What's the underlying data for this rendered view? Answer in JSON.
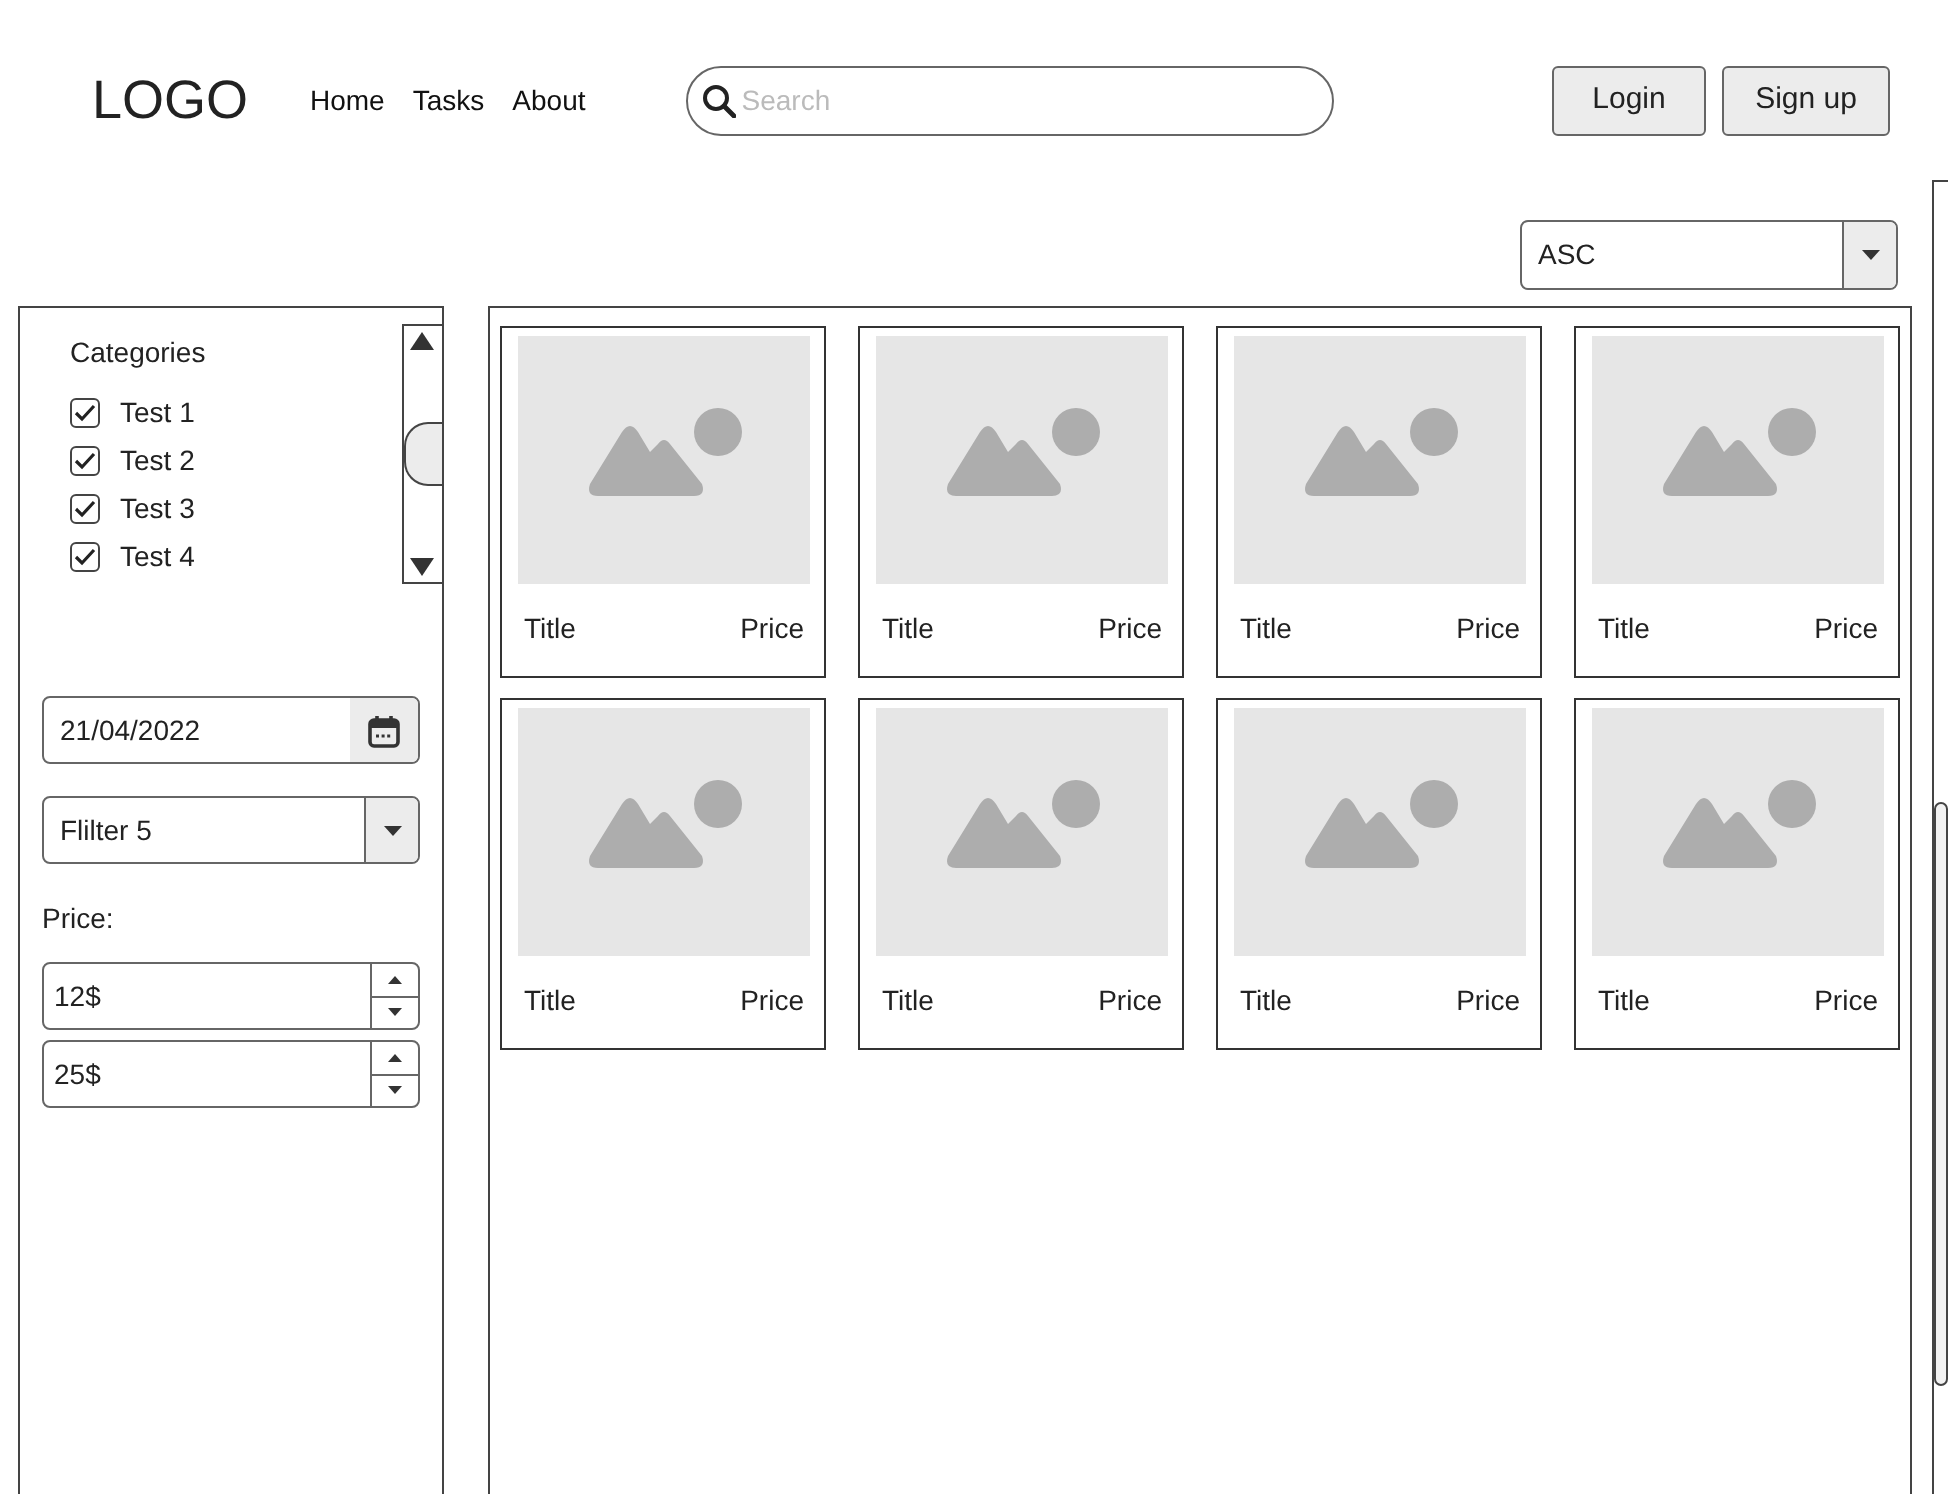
{
  "logo": "LOGO",
  "nav": [
    {
      "label": "Home"
    },
    {
      "label": "Tasks"
    },
    {
      "label": "About"
    }
  ],
  "search": {
    "placeholder": "Search"
  },
  "buttons": [
    "Login",
    "Sign up"
  ],
  "sort": {
    "value": "ASC"
  },
  "sidebar": {
    "categories_title": "Categories",
    "categories": [
      {
        "label": "Test 1",
        "checked": true
      },
      {
        "label": "Test 2",
        "checked": true
      },
      {
        "label": "Test 3",
        "checked": true
      },
      {
        "label": "Test 4",
        "checked": true
      }
    ],
    "date": "21/04/2022",
    "filter": "Flilter 5",
    "price_label": "Price:",
    "price_min": "12$",
    "price_max": "25$"
  },
  "products": [
    {
      "title": "Title",
      "price": "Price"
    },
    {
      "title": "Title",
      "price": "Price"
    },
    {
      "title": "Title",
      "price": "Price"
    },
    {
      "title": "Title",
      "price": "Price"
    },
    {
      "title": "Title",
      "price": "Price"
    },
    {
      "title": "Title",
      "price": "Price"
    },
    {
      "title": "Title",
      "price": "Price"
    },
    {
      "title": "Title",
      "price": "Price"
    }
  ]
}
